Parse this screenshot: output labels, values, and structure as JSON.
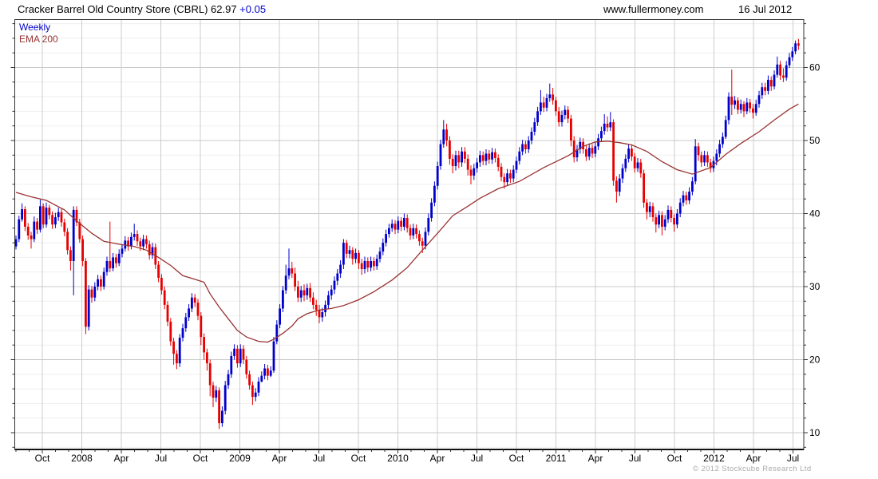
{
  "header": {
    "title": "Cracker Barrel Old Country Store (CBRL) 62.97",
    "change": "+0.05",
    "site": "www.fullermoney.com",
    "date": "16 Jul 2012"
  },
  "legend": {
    "timeframe": "Weekly",
    "overlay": "EMA 200"
  },
  "footer": {
    "copyright": "© 2012 Stockcube Research Ltd"
  },
  "colors": {
    "up": "#0000cc",
    "down": "#e60000",
    "ema": "#993333",
    "change_text": "#0000cc",
    "grid_minor": "#efefef",
    "grid_major": "#c8c8c8",
    "grid_vertical": "#cccccc",
    "border": "#333333",
    "tick": "#333333",
    "label": "#000000"
  },
  "chart_data": {
    "type": "candlestick",
    "title": "Cracker Barrel Old Country Store (CBRL)",
    "ticker": "CBRL",
    "timeframe": "Weekly",
    "last_price": 62.97,
    "change": "+0.05",
    "overlay": "EMA 200",
    "grid": true,
    "legend_position": "top-left",
    "y_axis": {
      "side": "right",
      "major_ticks": [
        10,
        20,
        30,
        40,
        50,
        60
      ],
      "minor_step": 2,
      "ylim": [
        7.7,
        66.5
      ]
    },
    "x_axis": {
      "quarter_labels": [
        "Oct",
        "2008",
        "Apr",
        "Jul",
        "Oct",
        "2009",
        "Apr",
        "Jul",
        "Oct",
        "2010",
        "Apr",
        "Jul",
        "Oct",
        "2011",
        "Apr",
        "Jul",
        "Oct",
        "2012",
        "Apr",
        "Jul"
      ],
      "start": "Aug 2007",
      "end": "Jul 2012"
    },
    "open_rule": "previous_close",
    "first_open": 35.5,
    "candles_format": [
      "low",
      "high",
      "close"
    ],
    "candles": [
      [
        35.1,
        37.0,
        36.5
      ],
      [
        36.1,
        39.7,
        39.2
      ],
      [
        38.9,
        41.4,
        40.6
      ],
      [
        37.6,
        41.0,
        38.2
      ],
      [
        36.4,
        38.7,
        37.0
      ],
      [
        35.2,
        37.5,
        36.5
      ],
      [
        36.1,
        39.6,
        38.9
      ],
      [
        37.2,
        39.4,
        37.8
      ],
      [
        37.4,
        41.9,
        41.0
      ],
      [
        38.0,
        41.4,
        38.5
      ],
      [
        38.1,
        41.5,
        40.8
      ],
      [
        39.2,
        41.2,
        39.8
      ],
      [
        37.9,
        40.3,
        38.5
      ],
      [
        38.0,
        40.1,
        39.5
      ],
      [
        39.0,
        40.8,
        40.2
      ],
      [
        38.2,
        40.7,
        38.8
      ],
      [
        36.9,
        39.3,
        37.5
      ],
      [
        34.4,
        38.0,
        35.0
      ],
      [
        32.2,
        35.5,
        33.5
      ],
      [
        28.8,
        41.0,
        40.5
      ],
      [
        38.3,
        41.0,
        38.8
      ],
      [
        36.0,
        39.3,
        36.5
      ],
      [
        32.8,
        37.0,
        33.5
      ],
      [
        23.5,
        33.9,
        24.5
      ],
      [
        24.0,
        30.2,
        29.6
      ],
      [
        27.8,
        30.1,
        28.5
      ],
      [
        28.0,
        30.6,
        30.0
      ],
      [
        29.5,
        31.6,
        31.0
      ],
      [
        29.4,
        31.5,
        30.0
      ],
      [
        29.6,
        32.6,
        32.0
      ],
      [
        31.5,
        34.1,
        33.5
      ],
      [
        32.0,
        38.9,
        32.5
      ],
      [
        32.1,
        34.6,
        34.0
      ],
      [
        32.6,
        34.5,
        33.2
      ],
      [
        32.8,
        35.1,
        34.5
      ],
      [
        34.0,
        35.8,
        35.2
      ],
      [
        34.8,
        36.9,
        36.3
      ],
      [
        34.9,
        36.8,
        35.5
      ],
      [
        35.1,
        37.4,
        36.8
      ],
      [
        36.3,
        38.6,
        37.2
      ],
      [
        35.6,
        37.7,
        36.2
      ],
      [
        34.9,
        36.7,
        35.5
      ],
      [
        35.0,
        37.1,
        36.5
      ],
      [
        35.2,
        37.0,
        35.8
      ],
      [
        33.7,
        36.3,
        34.3
      ],
      [
        33.8,
        36.0,
        35.4
      ],
      [
        32.4,
        35.9,
        33.0
      ],
      [
        30.6,
        33.5,
        31.2
      ],
      [
        28.9,
        31.7,
        29.5
      ],
      [
        26.9,
        30.0,
        27.5
      ],
      [
        24.6,
        28.0,
        25.2
      ],
      [
        21.9,
        25.7,
        22.5
      ],
      [
        19.3,
        23.0,
        20.8
      ],
      [
        18.7,
        21.3,
        19.5
      ],
      [
        19.0,
        23.5,
        23.0
      ],
      [
        22.5,
        24.9,
        24.3
      ],
      [
        23.8,
        26.4,
        25.8
      ],
      [
        25.3,
        27.6,
        27.0
      ],
      [
        26.5,
        29.1,
        28.5
      ],
      [
        27.2,
        29.0,
        27.8
      ],
      [
        25.4,
        28.3,
        26.0
      ],
      [
        22.0,
        26.5,
        23.1
      ],
      [
        20.0,
        23.6,
        21.0
      ],
      [
        18.5,
        21.5,
        19.5
      ],
      [
        15.0,
        20.0,
        16.5
      ],
      [
        13.5,
        17.0,
        14.8
      ],
      [
        14.2,
        16.4,
        15.8
      ],
      [
        10.5,
        16.2,
        11.3
      ],
      [
        10.8,
        13.6,
        13.0
      ],
      [
        12.5,
        17.1,
        16.5
      ],
      [
        16.0,
        18.6,
        18.0
      ],
      [
        17.5,
        21.1,
        20.5
      ],
      [
        20.0,
        22.1,
        21.5
      ],
      [
        18.9,
        22.0,
        19.5
      ],
      [
        19.0,
        22.1,
        21.5
      ],
      [
        19.4,
        22.0,
        20.0
      ],
      [
        17.4,
        20.5,
        18.0
      ],
      [
        15.9,
        18.5,
        16.5
      ],
      [
        13.8,
        17.0,
        14.9
      ],
      [
        14.3,
        16.1,
        15.5
      ],
      [
        15.0,
        17.6,
        17.0
      ],
      [
        16.9,
        18.4,
        17.8
      ],
      [
        17.3,
        19.4,
        18.8
      ],
      [
        17.2,
        19.3,
        17.8
      ],
      [
        17.6,
        19.1,
        18.5
      ],
      [
        18.2,
        23.1,
        22.5
      ],
      [
        22.1,
        25.4,
        24.8
      ],
      [
        24.3,
        27.6,
        27.0
      ],
      [
        26.5,
        30.1,
        29.5
      ],
      [
        29.0,
        33.0,
        31.5
      ],
      [
        31.0,
        35.2,
        32.5
      ],
      [
        31.2,
        33.4,
        31.8
      ],
      [
        29.4,
        32.6,
        30.0
      ],
      [
        27.9,
        30.8,
        28.5
      ],
      [
        27.9,
        30.1,
        29.5
      ],
      [
        28.0,
        30.3,
        28.8
      ],
      [
        28.2,
        30.4,
        29.8
      ],
      [
        27.9,
        30.5,
        28.5
      ],
      [
        26.9,
        29.2,
        27.5
      ],
      [
        26.0,
        28.2,
        26.8
      ],
      [
        25.0,
        27.5,
        25.8
      ],
      [
        25.2,
        27.1,
        26.5
      ],
      [
        25.9,
        28.1,
        27.5
      ],
      [
        26.9,
        29.4,
        28.8
      ],
      [
        28.2,
        30.2,
        29.6
      ],
      [
        29.0,
        31.4,
        30.8
      ],
      [
        30.2,
        32.4,
        31.8
      ],
      [
        31.2,
        33.6,
        33.0
      ],
      [
        32.4,
        36.5,
        36.0
      ],
      [
        33.9,
        36.4,
        34.5
      ],
      [
        33.9,
        35.6,
        35.0
      ],
      [
        33.0,
        35.4,
        33.8
      ],
      [
        33.2,
        35.2,
        34.6
      ],
      [
        32.4,
        35.0,
        33.2
      ],
      [
        31.6,
        33.8,
        32.4
      ],
      [
        31.8,
        34.1,
        33.5
      ],
      [
        32.0,
        34.0,
        32.6
      ],
      [
        32.1,
        34.1,
        33.5
      ],
      [
        32.2,
        34.0,
        32.8
      ],
      [
        32.3,
        34.4,
        33.8
      ],
      [
        33.3,
        35.4,
        34.8
      ],
      [
        34.3,
        36.6,
        36.0
      ],
      [
        35.5,
        37.8,
        37.2
      ],
      [
        36.7,
        38.6,
        38.0
      ],
      [
        37.5,
        39.2,
        38.6
      ],
      [
        37.2,
        39.1,
        37.8
      ],
      [
        37.3,
        39.6,
        39.0
      ],
      [
        37.6,
        39.5,
        38.2
      ],
      [
        37.7,
        40.0,
        39.4
      ],
      [
        37.4,
        39.9,
        38.0
      ],
      [
        36.4,
        38.5,
        37.0
      ],
      [
        36.5,
        38.6,
        38.0
      ],
      [
        36.6,
        38.5,
        37.2
      ],
      [
        35.6,
        37.7,
        36.2
      ],
      [
        34.6,
        36.7,
        35.6
      ],
      [
        35.1,
        38.1,
        37.5
      ],
      [
        37.0,
        40.0,
        39.4
      ],
      [
        38.9,
        42.1,
        41.5
      ],
      [
        41.0,
        44.4,
        43.8
      ],
      [
        43.3,
        47.1,
        46.5
      ],
      [
        46.0,
        50.1,
        49.5
      ],
      [
        49.0,
        52.8,
        51.5
      ],
      [
        49.2,
        52.3,
        50.0
      ],
      [
        46.7,
        50.6,
        47.5
      ],
      [
        45.5,
        48.1,
        46.5
      ],
      [
        45.9,
        48.6,
        48.0
      ],
      [
        46.2,
        48.6,
        47.0
      ],
      [
        46.4,
        49.1,
        48.5
      ],
      [
        46.9,
        49.1,
        47.5
      ],
      [
        45.2,
        48.1,
        46.0
      ],
      [
        44.0,
        46.6,
        45.2
      ],
      [
        44.6,
        46.8,
        46.2
      ],
      [
        45.6,
        47.6,
        47.0
      ],
      [
        46.4,
        48.6,
        48.0
      ],
      [
        46.6,
        48.5,
        47.2
      ],
      [
        46.6,
        48.8,
        48.2
      ],
      [
        46.8,
        48.7,
        47.4
      ],
      [
        46.8,
        49.0,
        48.4
      ],
      [
        47.0,
        48.9,
        47.6
      ],
      [
        45.8,
        48.1,
        46.4
      ],
      [
        44.4,
        46.9,
        45.0
      ],
      [
        43.4,
        45.5,
        44.3
      ],
      [
        43.8,
        46.1,
        45.5
      ],
      [
        44.2,
        46.0,
        44.8
      ],
      [
        44.3,
        46.6,
        46.0
      ],
      [
        45.5,
        47.8,
        47.2
      ],
      [
        46.7,
        49.1,
        48.5
      ],
      [
        48.0,
        50.1,
        49.5
      ],
      [
        48.2,
        50.0,
        48.8
      ],
      [
        48.3,
        50.6,
        50.0
      ],
      [
        49.5,
        51.8,
        51.2
      ],
      [
        50.7,
        53.1,
        52.5
      ],
      [
        52.0,
        54.6,
        54.0
      ],
      [
        53.5,
        56.9,
        55.2
      ],
      [
        53.9,
        56.0,
        54.5
      ],
      [
        54.0,
        56.4,
        55.8
      ],
      [
        55.3,
        57.8,
        56.3
      ],
      [
        54.9,
        57.2,
        55.5
      ],
      [
        53.4,
        56.0,
        54.0
      ],
      [
        51.9,
        54.6,
        52.5
      ],
      [
        51.9,
        54.1,
        53.5
      ],
      [
        52.9,
        54.8,
        54.2
      ],
      [
        52.4,
        54.7,
        53.0
      ],
      [
        49.2,
        53.5,
        50.0
      ],
      [
        47.0,
        50.6,
        47.7
      ],
      [
        47.1,
        49.4,
        48.8
      ],
      [
        48.2,
        50.4,
        49.8
      ],
      [
        48.2,
        50.3,
        48.8
      ],
      [
        47.2,
        49.4,
        47.8
      ],
      [
        47.3,
        49.6,
        49.0
      ],
      [
        47.6,
        49.5,
        48.2
      ],
      [
        47.7,
        49.8,
        49.2
      ],
      [
        48.7,
        50.9,
        50.3
      ],
      [
        49.8,
        51.9,
        51.3
      ],
      [
        50.8,
        53.6,
        52.3
      ],
      [
        51.2,
        53.3,
        51.8
      ],
      [
        51.3,
        53.9,
        52.5
      ],
      [
        43.8,
        52.9,
        44.5
      ],
      [
        41.5,
        45.1,
        43.0
      ],
      [
        42.4,
        45.4,
        44.8
      ],
      [
        44.2,
        46.8,
        46.2
      ],
      [
        45.7,
        48.1,
        47.5
      ],
      [
        47.0,
        49.5,
        48.9
      ],
      [
        47.2,
        49.4,
        47.8
      ],
      [
        45.6,
        48.3,
        46.2
      ],
      [
        45.7,
        47.6,
        47.0
      ],
      [
        44.9,
        47.5,
        45.5
      ],
      [
        40.8,
        46.0,
        41.5
      ],
      [
        39.2,
        42.0,
        40.2
      ],
      [
        39.5,
        41.6,
        41.0
      ],
      [
        38.9,
        41.5,
        39.5
      ],
      [
        37.4,
        40.0,
        38.5
      ],
      [
        38.0,
        40.4,
        39.8
      ],
      [
        37.0,
        40.3,
        38.2
      ],
      [
        37.7,
        39.8,
        39.2
      ],
      [
        38.7,
        41.1,
        40.5
      ],
      [
        38.8,
        41.0,
        39.4
      ],
      [
        37.5,
        39.9,
        38.5
      ],
      [
        38.0,
        40.6,
        40.0
      ],
      [
        39.5,
        42.1,
        41.5
      ],
      [
        41.0,
        43.1,
        42.5
      ],
      [
        41.2,
        43.0,
        41.8
      ],
      [
        41.3,
        43.6,
        43.0
      ],
      [
        42.5,
        45.0,
        44.4
      ],
      [
        44.0,
        50.2,
        49.2
      ],
      [
        47.2,
        49.7,
        48.0
      ],
      [
        46.4,
        48.5,
        47.0
      ],
      [
        46.5,
        48.6,
        48.0
      ],
      [
        46.4,
        48.5,
        47.0
      ],
      [
        45.6,
        47.5,
        46.2
      ],
      [
        45.7,
        47.8,
        47.2
      ],
      [
        46.6,
        48.8,
        48.2
      ],
      [
        47.7,
        50.1,
        49.5
      ],
      [
        49.0,
        51.1,
        50.5
      ],
      [
        50.2,
        53.4,
        52.8
      ],
      [
        52.2,
        56.6,
        56.0
      ],
      [
        53.5,
        59.7,
        54.9
      ],
      [
        54.3,
        56.1,
        55.5
      ],
      [
        53.6,
        55.9,
        54.2
      ],
      [
        53.7,
        55.6,
        55.0
      ],
      [
        53.2,
        55.4,
        54.0
      ],
      [
        53.6,
        55.8,
        55.2
      ],
      [
        53.8,
        55.7,
        54.4
      ],
      [
        53.0,
        55.0,
        53.8
      ],
      [
        53.4,
        55.6,
        55.0
      ],
      [
        54.5,
        56.8,
        56.2
      ],
      [
        55.7,
        57.9,
        57.3
      ],
      [
        56.2,
        57.9,
        56.8
      ],
      [
        56.3,
        58.9,
        58.3
      ],
      [
        56.8,
        58.8,
        57.4
      ],
      [
        57.0,
        59.6,
        59.0
      ],
      [
        58.6,
        61.5,
        60.4
      ],
      [
        58.3,
        60.9,
        58.9
      ],
      [
        58.0,
        59.9,
        58.6
      ],
      [
        58.2,
        60.9,
        60.3
      ],
      [
        59.9,
        62.0,
        61.4
      ],
      [
        60.9,
        62.8,
        62.2
      ],
      [
        61.8,
        63.7,
        63.3
      ],
      [
        62.4,
        63.9,
        62.97
      ]
    ],
    "ema": {
      "label": "EMA 200",
      "points_format": [
        "week_index",
        "value"
      ],
      "points": [
        [
          0,
          42.9
        ],
        [
          5,
          42.3
        ],
        [
          10,
          41.8
        ],
        [
          16,
          40.5
        ],
        [
          20,
          39.0
        ],
        [
          25,
          37.3
        ],
        [
          29,
          36.2
        ],
        [
          34,
          35.8
        ],
        [
          39,
          35.5
        ],
        [
          43,
          35.0
        ],
        [
          47,
          34.0
        ],
        [
          51,
          32.9
        ],
        [
          55,
          31.5
        ],
        [
          59,
          31.0
        ],
        [
          62,
          30.6
        ],
        [
          64,
          29.0
        ],
        [
          67,
          27.2
        ],
        [
          70,
          25.6
        ],
        [
          73,
          24.0
        ],
        [
          76,
          23.1
        ],
        [
          80,
          22.5
        ],
        [
          83,
          22.4
        ],
        [
          85,
          22.8
        ],
        [
          88,
          23.6
        ],
        [
          91,
          24.6
        ],
        [
          93,
          25.6
        ],
        [
          96,
          26.3
        ],
        [
          100,
          26.8
        ],
        [
          104,
          27.0
        ],
        [
          108,
          27.4
        ],
        [
          113,
          28.2
        ],
        [
          118,
          29.3
        ],
        [
          124,
          30.9
        ],
        [
          129,
          32.6
        ],
        [
          134,
          35.0
        ],
        [
          139,
          37.3
        ],
        [
          144,
          39.7
        ],
        [
          149,
          41.0
        ],
        [
          153,
          42.1
        ],
        [
          159,
          43.4
        ],
        [
          166,
          44.4
        ],
        [
          174,
          46.3
        ],
        [
          182,
          47.9
        ],
        [
          187,
          49.2
        ],
        [
          191,
          49.8
        ],
        [
          195,
          49.9
        ],
        [
          199,
          49.7
        ],
        [
          203,
          49.4
        ],
        [
          208,
          48.5
        ],
        [
          213,
          47.1
        ],
        [
          218,
          46.0
        ],
        [
          223,
          45.4
        ],
        [
          229,
          46.3
        ],
        [
          234,
          48.1
        ],
        [
          239,
          49.6
        ],
        [
          245,
          51.2
        ],
        [
          250,
          52.8
        ],
        [
          255,
          54.3
        ],
        [
          258,
          55.0
        ]
      ]
    }
  }
}
